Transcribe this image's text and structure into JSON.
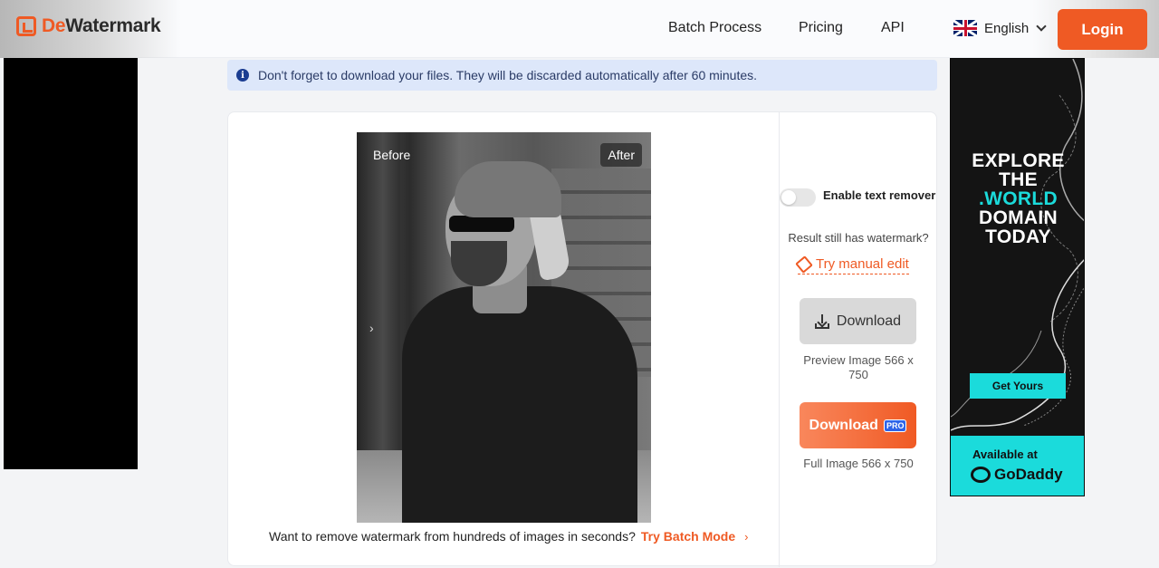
{
  "header": {
    "logo_prefix": "De",
    "logo_suffix": "Watermark",
    "nav": [
      "Batch Process",
      "Pricing",
      "API"
    ],
    "language": "English",
    "login_label": "Login"
  },
  "notice": {
    "text": "Don't forget to download your files. They will be discarded automatically after 60 minutes."
  },
  "preview": {
    "before_label": "Before",
    "after_label": "After",
    "slider_arrow": "›"
  },
  "promo": {
    "text": "Want to remove watermark from hundreds of images in seconds?",
    "link": "Try Batch Mode",
    "arrow": "›"
  },
  "panel": {
    "toggle_label": "Enable text remover",
    "still_has": "Result still has watermark?",
    "manual_edit": "Try manual edit",
    "download_label": "Download",
    "preview_info": "Preview Image 566 x 750",
    "download_pro_label": "Download",
    "pro_badge": "PRO",
    "full_info": "Full Image 566 x 750"
  },
  "ad": {
    "line1": "EXPLORE",
    "line2": "THE",
    "line3": ".WORLD",
    "line4": "DOMAIN",
    "line5": "TODAY",
    "button": "Get Yours",
    "available": "Available at",
    "brand": "GoDaddy"
  },
  "colors": {
    "accent": "#ef5a24",
    "notice_bg": "#dde7fa",
    "ad_teal": "#1bdbdb"
  },
  "icons": {
    "logo": "dewatermark-logo-icon",
    "info": "info-icon",
    "flag": "uk-flag-icon",
    "chevron": "chevron-down-icon",
    "eraser": "eraser-icon",
    "download": "download-icon"
  }
}
